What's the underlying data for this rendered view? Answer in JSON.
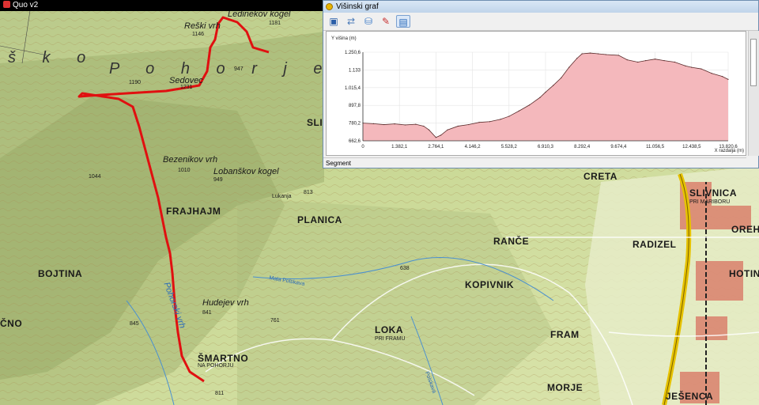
{
  "app_title": "Quo v2",
  "graph_window": {
    "title": "Višinski graf",
    "status": "Segment",
    "toolbar": [
      {
        "icon": "save-icon"
      },
      {
        "icon": "refresh-icon"
      },
      {
        "icon": "database-icon"
      },
      {
        "icon": "eraser-icon"
      },
      {
        "icon": "window-icon"
      }
    ]
  },
  "chart_data": {
    "type": "area",
    "ylabel": "Y višina (m)",
    "xlabel": "X razdalja (m)",
    "xlim": [
      0,
      13820.6
    ],
    "ylim": [
      662.6,
      1250.6
    ],
    "xticks": [
      "0",
      "1.382,1",
      "2.764,1",
      "4.146,2",
      "5.528,2",
      "6.910,3",
      "8.292,4",
      "9.674,4",
      "11.056,5",
      "12.438,5",
      "13.820,6"
    ],
    "yticks": [
      "662,6",
      "780,2",
      "897,8",
      "1.015,4",
      "1.133",
      "1.250,6"
    ],
    "fill": "#f4b8bc",
    "line": "#5a2a2a",
    "x": [
      0,
      400,
      800,
      1200,
      1600,
      2000,
      2300,
      2500,
      2764,
      2950,
      3200,
      3600,
      4000,
      4400,
      4800,
      5200,
      5528,
      5900,
      6300,
      6700,
      6910,
      7200,
      7500,
      7800,
      8100,
      8292,
      8600,
      8900,
      9200,
      9674,
      10000,
      10400,
      10700,
      11056,
      11400,
      11800,
      12200,
      12438,
      12800,
      13200,
      13600,
      13820
    ],
    "y": [
      780,
      776,
      770,
      775,
      768,
      772,
      760,
      735,
      685,
      700,
      735,
      760,
      770,
      785,
      790,
      805,
      825,
      860,
      900,
      950,
      985,
      1030,
      1080,
      1150,
      1210,
      1240,
      1245,
      1240,
      1235,
      1230,
      1200,
      1185,
      1195,
      1205,
      1195,
      1185,
      1160,
      1150,
      1140,
      1110,
      1090,
      1070
    ]
  },
  "map": {
    "labels": [
      {
        "t": "Ledinekov kogel",
        "cls": "med",
        "pos": "l1"
      },
      {
        "t": "Reški vrh",
        "cls": "med",
        "pos": "l2"
      },
      {
        "t": "1146",
        "cls": "sm",
        "pos": "l3"
      },
      {
        "t": "1181",
        "cls": "sm",
        "pos": "l4"
      },
      {
        "t": "š k o",
        "cls": "reg",
        "pos": "l5"
      },
      {
        "t": "P o h o r j e",
        "cls": "reg",
        "pos": "l6"
      },
      {
        "t": "Sedovec",
        "cls": "med",
        "pos": "l7"
      },
      {
        "t": "1231",
        "cls": "sm",
        "pos": "l8"
      },
      {
        "t": "1190",
        "cls": "sm",
        "pos": "l9"
      },
      {
        "t": "947",
        "cls": "sm",
        "pos": "l10"
      },
      {
        "t": "SLIV",
        "cls": "big",
        "pos": "l11"
      },
      {
        "t": "Bezenikov vrh",
        "cls": "med",
        "pos": "l12"
      },
      {
        "t": "Lobanškov kogel",
        "cls": "med",
        "pos": "l13"
      },
      {
        "t": "1010",
        "cls": "sm",
        "pos": "l14"
      },
      {
        "t": "949",
        "cls": "sm",
        "pos": "l15"
      },
      {
        "t": "FRAJHAJM",
        "cls": "big",
        "pos": "l16"
      },
      {
        "t": "1044",
        "cls": "sm",
        "pos": "l17"
      },
      {
        "t": "PLANICA",
        "cls": "big",
        "pos": "l18"
      },
      {
        "t": "Lukanja",
        "cls": "sm",
        "pos": "l19"
      },
      {
        "t": "BOJTINA",
        "cls": "big",
        "pos": "l20"
      },
      {
        "t": "Hudejev vrh",
        "cls": "med",
        "pos": "l21"
      },
      {
        "t": "841",
        "cls": "sm",
        "pos": "l22"
      },
      {
        "t": "ŠMARTNO",
        "cls": "big",
        "pos": "l23"
      },
      {
        "t": "NA POHORJU",
        "cls": "sm",
        "pos": "l24"
      },
      {
        "t": "845",
        "cls": "sm",
        "pos": "l25"
      },
      {
        "t": "761",
        "cls": "sm",
        "pos": "l26"
      },
      {
        "t": "LOKA",
        "cls": "big",
        "pos": "l27"
      },
      {
        "t": "PRI FRAMU",
        "cls": "sm",
        "pos": "l28"
      },
      {
        "t": "KOPIVNIK",
        "cls": "big",
        "pos": "l29"
      },
      {
        "t": "RANČE",
        "cls": "big",
        "pos": "l30"
      },
      {
        "t": "RADIZEL",
        "cls": "big",
        "pos": "l31"
      },
      {
        "t": "FRAM",
        "cls": "big",
        "pos": "l32"
      },
      {
        "t": "MORJE",
        "cls": "big",
        "pos": "l33"
      },
      {
        "t": "CRETA",
        "cls": "big",
        "pos": "l34"
      },
      {
        "t": "SLIVNICA",
        "cls": "big",
        "pos": "l35"
      },
      {
        "t": "PRI MARIBORU",
        "cls": "sm",
        "pos": "l36"
      },
      {
        "t": "OREHO",
        "cls": "big",
        "pos": "l37"
      },
      {
        "t": "HOTIN",
        "cls": "big",
        "pos": "l38"
      },
      {
        "t": "JEŠENCA",
        "cls": "big",
        "pos": "l39"
      },
      {
        "t": "ČNO",
        "cls": "big",
        "pos": "l40"
      },
      {
        "t": "Pohorski vrh",
        "cls": "med",
        "pos": "l41"
      },
      {
        "t": "813",
        "cls": "sm",
        "pos": "l42"
      },
      {
        "t": "638",
        "cls": "sm",
        "pos": "l43"
      },
      {
        "t": "811",
        "cls": "sm",
        "pos": "l44"
      },
      {
        "t": "Mala Polskava",
        "cls": "sm",
        "pos": "l45"
      },
      {
        "t": "Polskava",
        "cls": "sm",
        "pos": "l46"
      }
    ]
  }
}
